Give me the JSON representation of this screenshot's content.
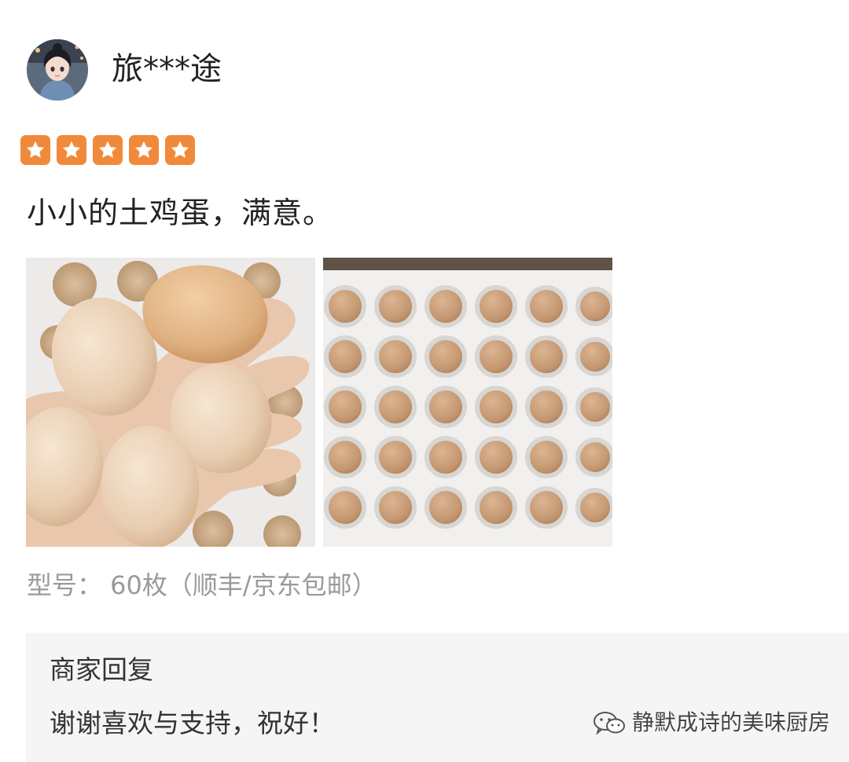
{
  "review": {
    "username": "旅***途",
    "avatar_icon": "avatar-girl-image",
    "rating": 5,
    "rating_max": 5,
    "text": "小小的土鸡蛋，满意。",
    "photos": [
      {
        "name": "photo-eggs-in-hand"
      },
      {
        "name": "photo-egg-tray"
      }
    ],
    "model": "型号： 60枚（顺丰/京东包邮）"
  },
  "merchant_reply": {
    "title": "商家回复",
    "text": "谢谢喜欢与支持，祝好！"
  },
  "watermark": {
    "icon": "wechat-icon",
    "text": "静默成诗的美味厨房"
  },
  "colors": {
    "star_bg": "#f08a3a",
    "text_primary": "#222222",
    "text_secondary": "#9a9a9a",
    "reply_bg": "#f5f5f5"
  }
}
